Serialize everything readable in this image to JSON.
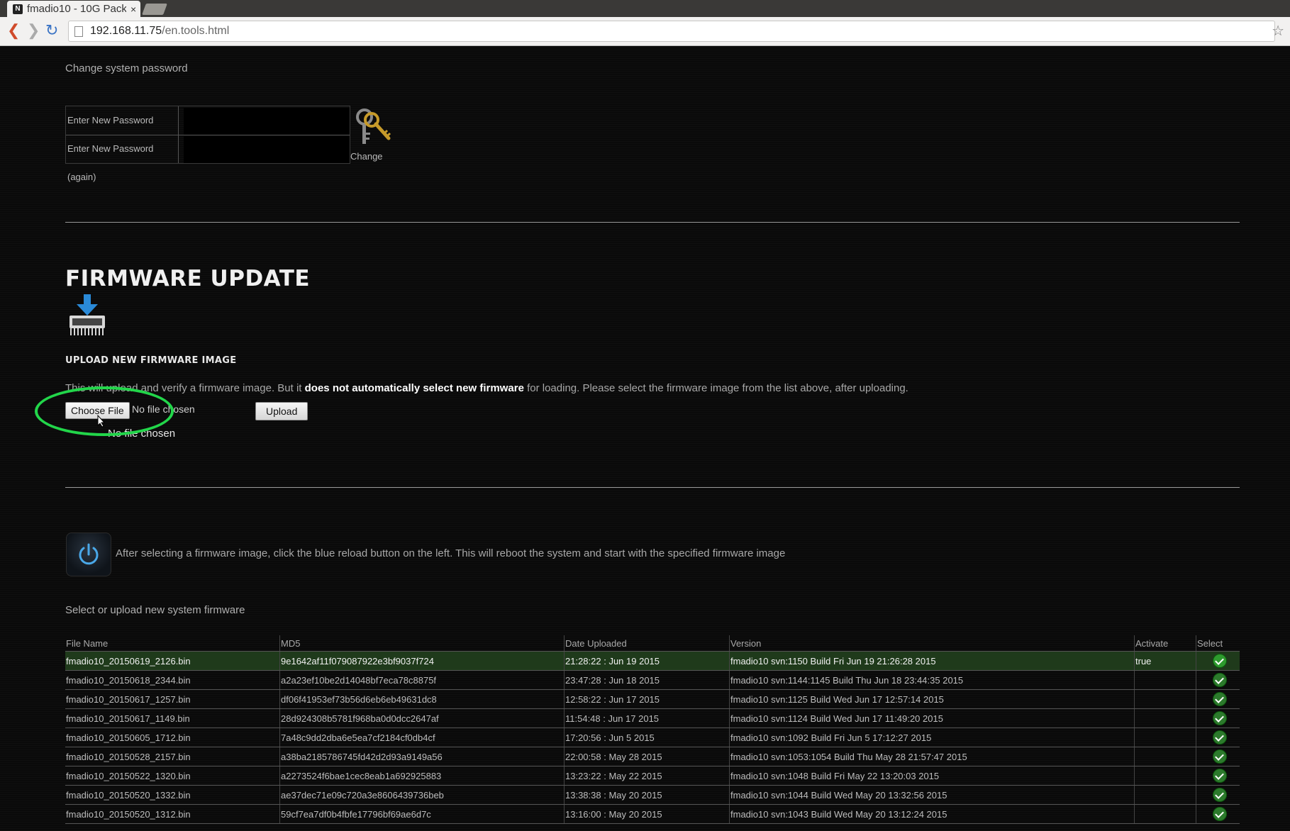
{
  "browser": {
    "tab_title": "fmadio10 - 10G Pack",
    "tab_favicon": "N",
    "url_host": "192.168.11.75",
    "url_path": "/en.tools.html"
  },
  "password": {
    "section_label": "Change system password",
    "new_label": "Enter New Password",
    "again_label": "Enter New Password (again)",
    "change_label": "Change",
    "icon": "keys-icon"
  },
  "firmware": {
    "title": "FIRMWARE UPDATE",
    "icon": "firmware-download-icon",
    "upload_heading": "UPLOAD NEW FIRMWARE IMAGE",
    "desc_pre": "This will upload and verify a firmware image. But it ",
    "desc_bold": "does not automatically select new firmware",
    "desc_post": " for loading. Please select the firmware image from the list above, after uploading.",
    "choose_file": "Choose File",
    "no_file_inline": "No file chosen",
    "upload": "Upload",
    "no_file_below": "No file chosen",
    "highlight_color": "#22d64a"
  },
  "reboot": {
    "note": "After selecting a firmware image, click the blue reload button on the left. This will reboot the system and start with the specified firmware image",
    "icon": "power-reload-icon"
  },
  "select_label": "Select or upload new system firmware",
  "table": {
    "headers": [
      "File Name",
      "MD5",
      "Date Uploaded",
      "Version",
      "Activate",
      "Select"
    ],
    "rows": [
      {
        "file": "fmadio10_20150619_2126.bin",
        "md5": "9e1642af11f079087922e3bf9037f724",
        "date": "21:28:22 : Jun 19 2015",
        "version": "fmadio10 svn:1150 Build Fri Jun 19 21:26:28 2015",
        "activate": "true"
      },
      {
        "file": "fmadio10_20150618_2344.bin",
        "md5": "a2a23ef10be2d14048bf7eca78c8875f",
        "date": "23:47:28 : Jun 18 2015",
        "version": "fmadio10 svn:1144:1145 Build Thu Jun 18 23:44:35 2015",
        "activate": ""
      },
      {
        "file": "fmadio10_20150617_1257.bin",
        "md5": "df06f41953ef73b56d6eb6eb49631dc8",
        "date": "12:58:22 : Jun 17 2015",
        "version": "fmadio10 svn:1125 Build Wed Jun 17 12:57:14 2015",
        "activate": ""
      },
      {
        "file": "fmadio10_20150617_1149.bin",
        "md5": "28d924308b5781f968ba0d0dcc2647af",
        "date": "11:54:48 : Jun 17 2015",
        "version": "fmadio10 svn:1124 Build Wed Jun 17 11:49:20 2015",
        "activate": ""
      },
      {
        "file": "fmadio10_20150605_1712.bin",
        "md5": "7a48c9dd2dba6e5ea7cf2184cf0db4cf",
        "date": "17:20:56 : Jun 5 2015",
        "version": "fmadio10 svn:1092 Build Fri Jun 5 17:12:27 2015",
        "activate": ""
      },
      {
        "file": "fmadio10_20150528_2157.bin",
        "md5": "a38ba2185786745fd42d2d93a9149a56",
        "date": "22:00:58 : May 28 2015",
        "version": "fmadio10 svn:1053:1054 Build Thu May 28 21:57:47 2015",
        "activate": ""
      },
      {
        "file": "fmadio10_20150522_1320.bin",
        "md5": "a2273524f6bae1cec8eab1a692925883",
        "date": "13:23:22 : May 22 2015",
        "version": "fmadio10 svn:1048 Build Fri May 22 13:20:03 2015",
        "activate": ""
      },
      {
        "file": "fmadio10_20150520_1332.bin",
        "md5": "ae37dec71e09c720a3e8606439736beb",
        "date": "13:38:38 : May 20 2015",
        "version": "fmadio10 svn:1044 Build Wed May 20 13:32:56 2015",
        "activate": ""
      },
      {
        "file": "fmadio10_20150520_1312.bin",
        "md5": "59cf7ea7df0b4fbfe17796bf69ae6d7c",
        "date": "13:16:00 : May 20 2015",
        "version": "fmadio10 svn:1043 Build Wed May 20 13:12:24 2015",
        "activate": ""
      }
    ]
  }
}
